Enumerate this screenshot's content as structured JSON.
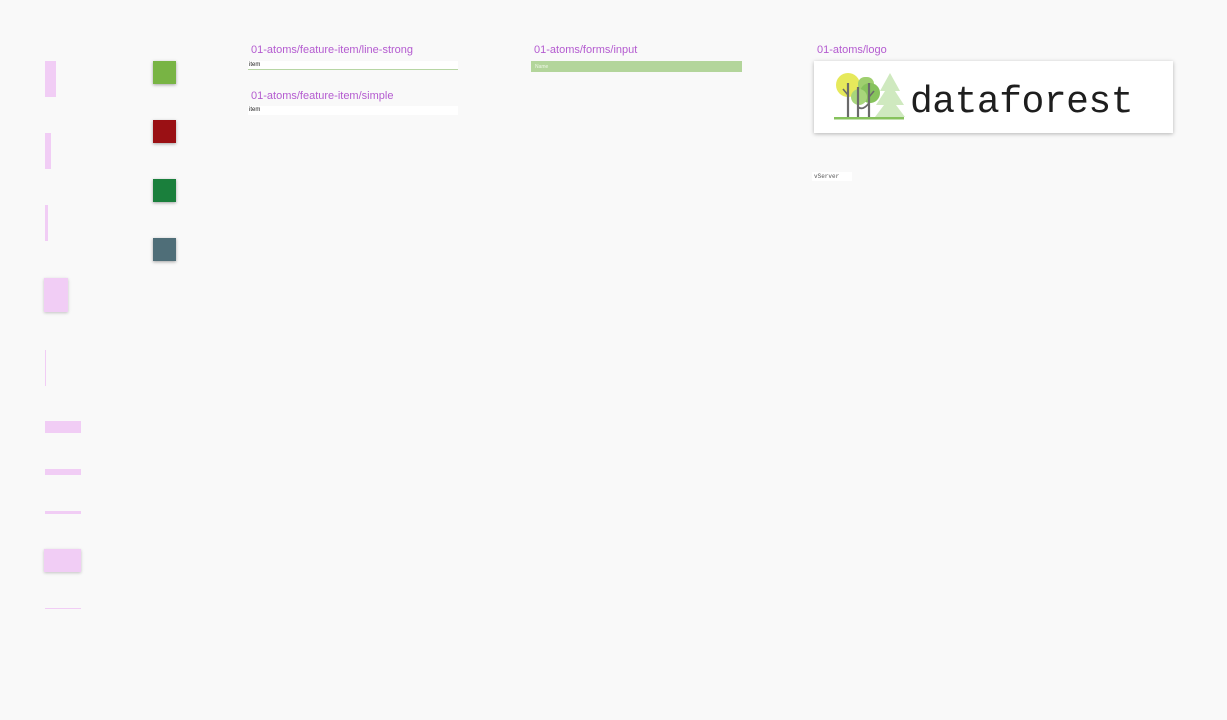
{
  "colors": {
    "canvas_bg": "#f9f9f9",
    "label_purple": "#b45bd0",
    "spacer_pink": "#f1cdf5",
    "input_green": "#b3d59b"
  },
  "swatches": [
    {
      "name": "green",
      "color": "#78b444"
    },
    {
      "name": "red",
      "color": "#9a1014"
    },
    {
      "name": "dark-green",
      "color": "#1a7f3c"
    },
    {
      "name": "slate",
      "color": "#4f6e78"
    }
  ],
  "frames": {
    "line_strong": {
      "label": "01-atoms/feature-item/line-strong",
      "item_text": "item"
    },
    "simple": {
      "label": "01-atoms/feature-item/simple",
      "item_text": "item"
    },
    "input": {
      "label": "01-atoms/forms/input",
      "placeholder": "Name"
    },
    "logo": {
      "label": "01-atoms/logo",
      "text": "dataforest"
    },
    "vserver": {
      "text": "vServer"
    }
  }
}
